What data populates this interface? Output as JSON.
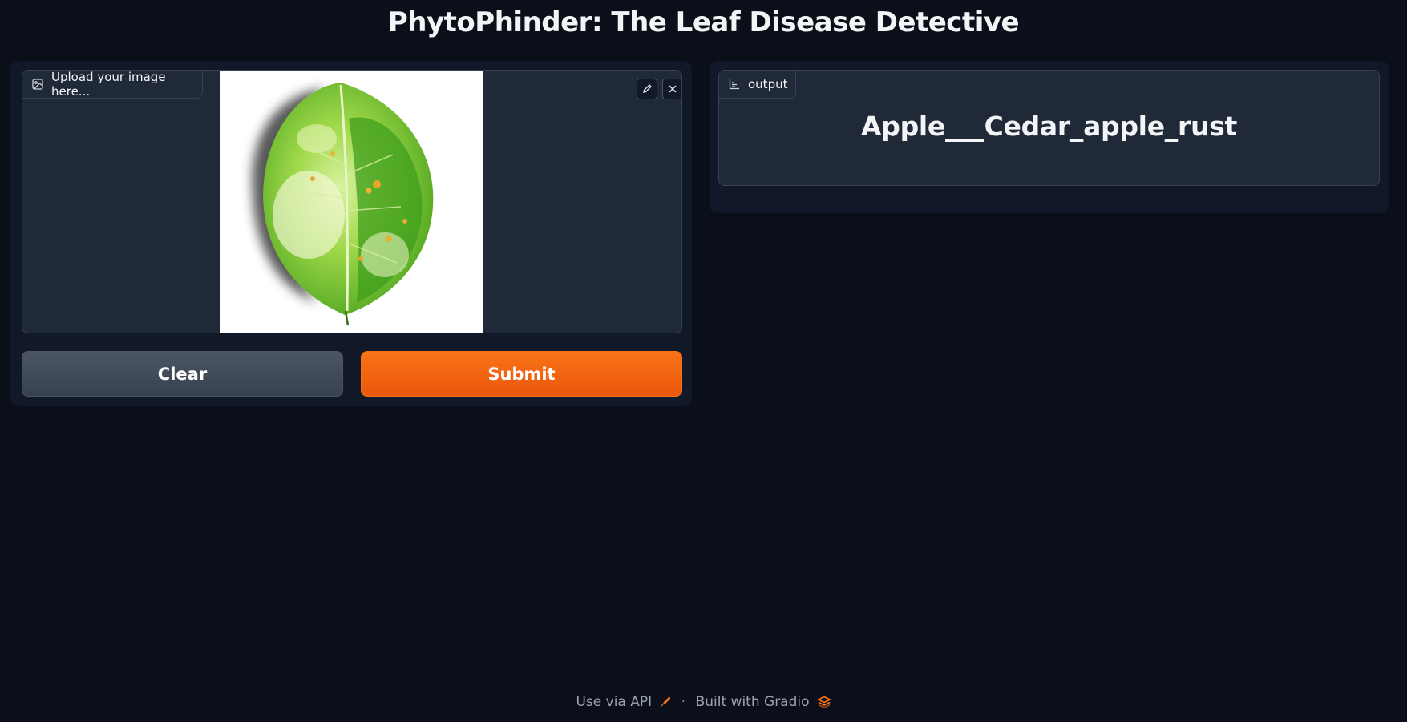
{
  "page": {
    "title": "PhytoPhinder: The Leaf Disease Detective"
  },
  "input_panel": {
    "image_label": "Upload your image here...",
    "image_icon": "image-icon",
    "edit_icon": "pencil-icon",
    "close_icon": "close-icon",
    "clear_label": "Clear",
    "submit_label": "Submit"
  },
  "output_panel": {
    "label": "output",
    "label_icon": "label-chart-icon",
    "value": "Apple___Cedar_apple_rust"
  },
  "footer": {
    "api_text": "Use via API",
    "separator": "·",
    "built_text": "Built with Gradio"
  },
  "colors": {
    "background": "#0b0f19",
    "panel": "#111827",
    "block": "#1f2937",
    "accent": "#f97316",
    "secondary_button": "#4b5563"
  }
}
